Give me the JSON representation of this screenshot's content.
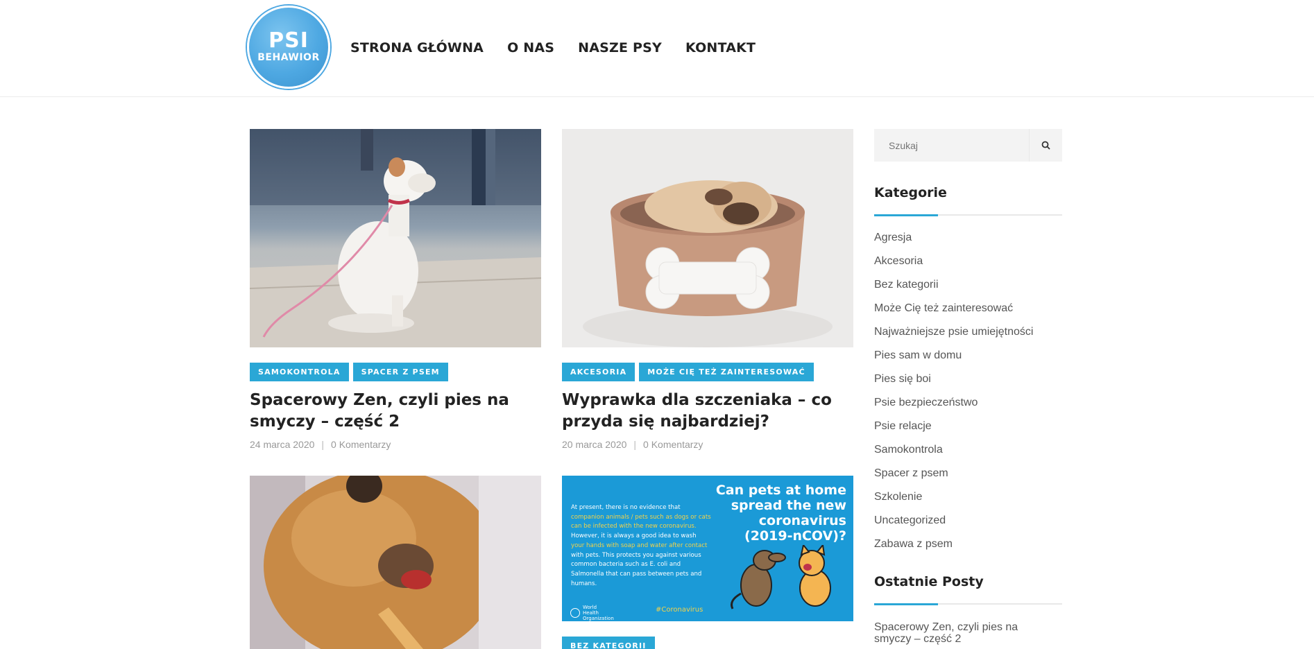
{
  "logo": {
    "line1": "PSI",
    "line2": "BEHAWIOR"
  },
  "nav": [
    "STRONA GŁÓWNA",
    "O NAS",
    "NASZE PSY",
    "KONTAKT"
  ],
  "posts": [
    {
      "tags": [
        "SAMOKONTROLA",
        "SPACER Z PSEM"
      ],
      "title": "Spacerowy Zen, czyli pies na smyczy – część 2",
      "date": "24 marca 2020",
      "comments": "0 Komentarzy"
    },
    {
      "tags": [
        "AKCESORIA",
        "MOŻE CIĘ TEŻ ZAINTERESOWAĆ"
      ],
      "title": "Wyprawka dla szczeniaka – co przyda się najbardziej?",
      "date": "20 marca 2020",
      "comments": "0 Komentarzy"
    },
    {
      "tags": [
        "BEZ KATEGORII"
      ]
    }
  ],
  "infographic": {
    "headline": "Can pets at home spread the new coronavirus (2019-nCOV)?",
    "body_lines": [
      "At present, there is no evidence that",
      "companion animals / pets such as dogs or cats",
      "can be infected with the new coronavirus.",
      "However, it is always a good idea to wash",
      "your hands with soap and water after contact",
      "with pets. This protects you against various",
      "common bacteria such as E. coli and",
      "Salmonella that can pass between pets and",
      "humans."
    ],
    "who": "World Health Organization",
    "hashtag": "#Coronavirus"
  },
  "sidebar": {
    "search_placeholder": "Szukaj",
    "categories_title": "Kategorie",
    "categories": [
      "Agresja",
      "Akcesoria",
      "Bez kategorii",
      "Może Cię też zainteresować",
      "Najważniejsze psie umiejętności",
      "Pies sam w domu",
      "Pies się boi",
      "Psie bezpieczeństwo",
      "Psie relacje",
      "Samokontrola",
      "Spacer z psem",
      "Szkolenie",
      "Uncategorized",
      "Zabawa z psem"
    ],
    "recent_title": "Ostatnie Posty",
    "recent_posts": [
      "Spacerowy Zen, czyli pies na smyczy – część 2"
    ]
  },
  "colors": {
    "accent": "#2aa7d6",
    "logo": "#4ea8e2",
    "who_blue": "#1b9ad7"
  }
}
